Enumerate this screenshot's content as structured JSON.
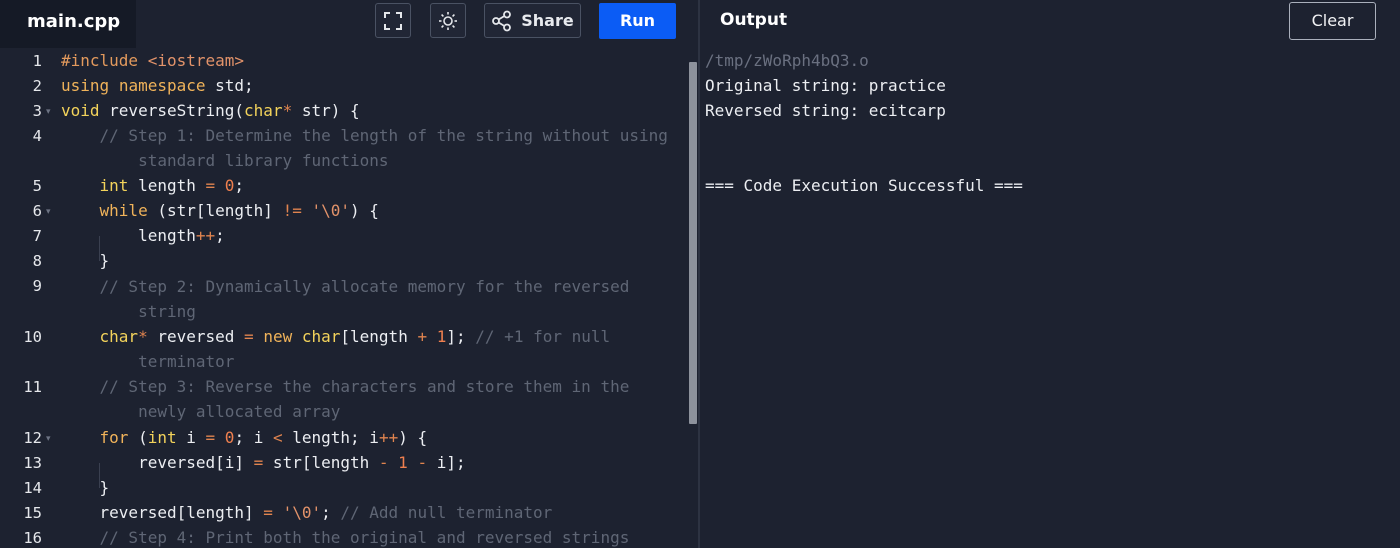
{
  "editor_tab": {
    "filename": "main.cpp"
  },
  "toolbar": {
    "fullscreen_icon": "fullscreen-icon",
    "theme_icon": "sun-icon",
    "share_icon": "share-icon",
    "share_label": "Share",
    "run_label": "Run"
  },
  "output_panel": {
    "title": "Output",
    "clear_label": "Clear",
    "lines": [
      "/tmp/zWoRph4bQ3.o",
      "Original string: practice",
      "Reversed string: ecitcarp",
      "",
      "",
      "=== Code Execution Successful ==="
    ]
  },
  "code": {
    "line_numbers": [
      "1",
      "2",
      "3",
      "4",
      "5",
      "6",
      "7",
      "8",
      "9",
      "10",
      "11",
      "12",
      "13",
      "14",
      "15",
      "16"
    ],
    "lines": [
      "#include <iostream>",
      "using namespace std;",
      "void reverseString(char* str) {",
      "    // Step 1: Determine the length of the string without using",
      "        standard library functions",
      "    int length = 0;",
      "    while (str[length] != '\\0') {",
      "        length++;",
      "    }",
      "    // Step 2: Dynamically allocate memory for the reversed",
      "        string",
      "    char* reversed = new char[length + 1]; // +1 for null",
      "        terminator",
      "    // Step 3: Reverse the characters and store them in the",
      "        newly allocated array",
      "    for (int i = 0; i < length; i++) {",
      "        reversed[i] = str[length - 1 - i];",
      "    }",
      "    reversed[length] = '\\0'; // Add null terminator",
      "    // Step 4: Print both the original and reversed strings"
    ]
  },
  "colors": {
    "background": "#1d2230",
    "run_button": "#0b5cf5",
    "keyword": "#f0b35a",
    "comment": "#5f6675"
  }
}
